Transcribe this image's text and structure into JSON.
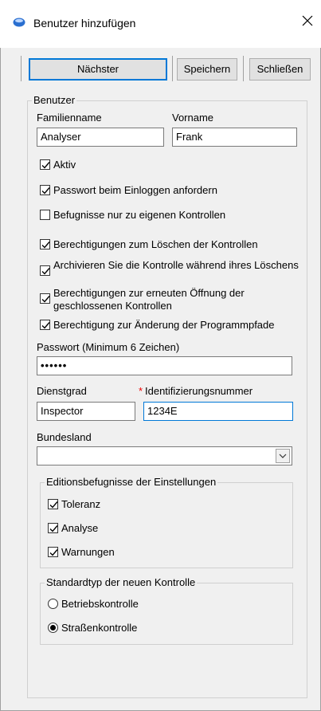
{
  "window": {
    "title": "Benutzer hinzufügen",
    "close_glyph": "✕"
  },
  "toolbar": {
    "next_label": "Nächster",
    "save_label": "Speichern",
    "close_label": "Schließen"
  },
  "user_group": {
    "legend": "Benutzer",
    "lastname_label": "Familienname",
    "lastname_value": "Analyser",
    "firstname_label": "Vorname",
    "firstname_value": "Frank",
    "checkboxes": [
      {
        "label": "Aktiv",
        "checked": true
      },
      {
        "label": "Passwort beim Einloggen anfordern",
        "checked": true
      },
      {
        "label": "Befugnisse nur zu eigenen Kontrollen",
        "checked": false
      },
      {
        "label": "Berechtigungen zum Löschen der Kontrollen",
        "checked": true
      },
      {
        "label": "Archivieren Sie die Kontrolle während ihres Löschens",
        "checked": true
      },
      {
        "label": "Berechtigungen zur erneuten Öffnung der geschlossenen Kontrollen",
        "checked": true
      },
      {
        "label": "Berechtigung zur Änderung der Programmpfade",
        "checked": true
      }
    ],
    "password_label": "Passwort (Minimum 6 Zeichen)",
    "password_value": "••••••",
    "rank_label": "Dienstgrad",
    "rank_value": "Inspector",
    "id_required_mark": "*",
    "id_label": "Identifizierungsnummer",
    "id_value": "1234E",
    "state_label": "Bundesland",
    "state_value": ""
  },
  "edit_rights": {
    "legend": "Editionsbefugnisse der Einstellungen",
    "items": [
      {
        "label": "Toleranz",
        "checked": true
      },
      {
        "label": "Analyse",
        "checked": true
      },
      {
        "label": "Warnungen",
        "checked": true
      }
    ]
  },
  "default_type": {
    "legend": "Standardtyp der neuen Kontrolle",
    "options": [
      {
        "label": "Betriebskontrolle",
        "selected": false
      },
      {
        "label": "Straßenkontrolle",
        "selected": true
      }
    ]
  },
  "icons": {
    "app": "app-icon",
    "close": "close-icon",
    "check": "check-icon",
    "dropdown": "chevron-down-icon"
  },
  "colors": {
    "accent": "#0078d7",
    "required": "#e00000"
  }
}
